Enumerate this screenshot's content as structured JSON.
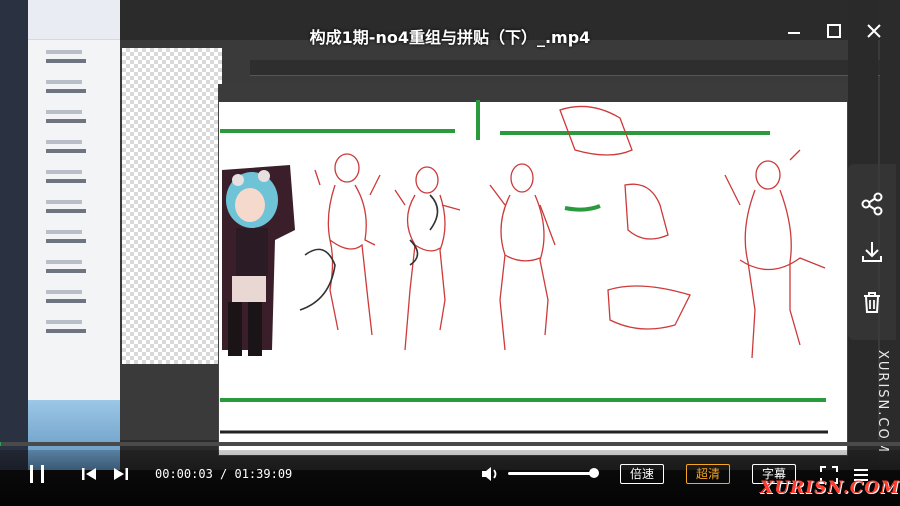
{
  "title": "构成1期-no4重组与拼贴（下）_.mp4",
  "window": {
    "minimize_icon": "minimize-icon",
    "maximize_icon": "maximize-icon",
    "close_icon": "close-icon"
  },
  "side_panel": {
    "items": [
      {
        "icon": "share-icon"
      },
      {
        "icon": "download-icon"
      },
      {
        "icon": "trash-icon"
      }
    ]
  },
  "video_overlay": {
    "watermark_vertical": "XURISN.COM",
    "brand_watermark": "XURISN.COM"
  },
  "playback": {
    "current_time": "00:00:03",
    "separator": " / ",
    "duration": "01:39:09",
    "time_display": "00:00:03 / 01:39:09",
    "progress": 0.0005,
    "volume": 1.0,
    "state": "paused"
  },
  "controls": {
    "speed_label": "倍速",
    "quality_label": "超清",
    "subtitle_label": "字幕"
  },
  "colors": {
    "accent_green": "#2ea44f",
    "quality_orange": "#f5a623",
    "brand_red": "#ff3b2f"
  }
}
